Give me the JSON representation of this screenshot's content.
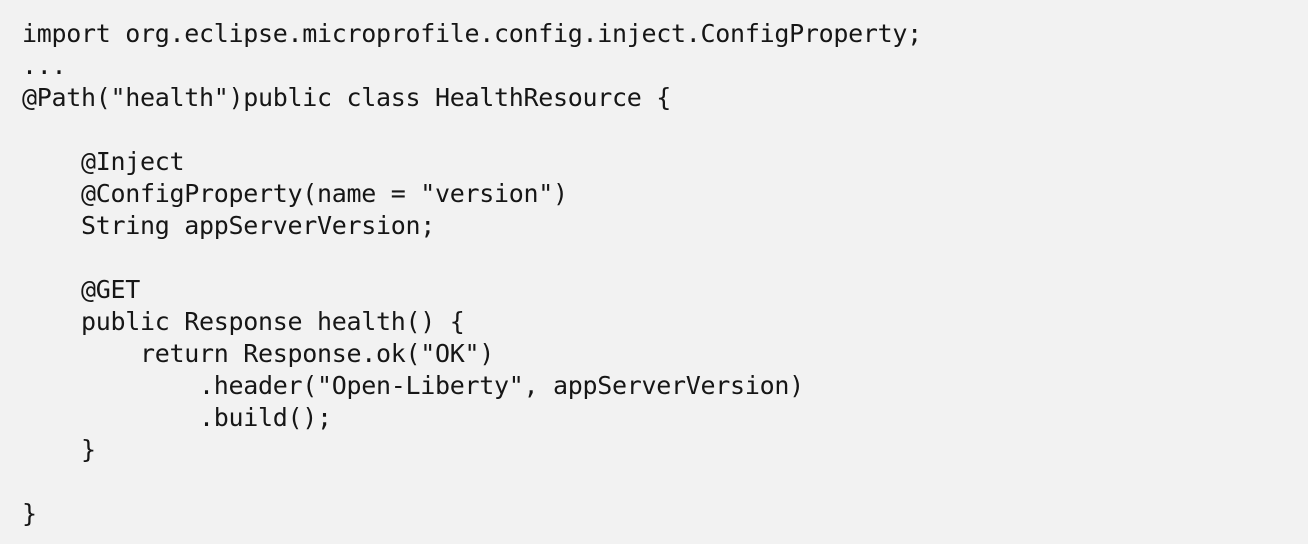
{
  "code": {
    "lines": [
      "import org.eclipse.microprofile.config.inject.ConfigProperty;",
      "...",
      "@Path(\"health\")public class HealthResource {",
      "",
      "    @Inject",
      "    @ConfigProperty(name = \"version\")",
      "    String appServerVersion;",
      "",
      "    @GET",
      "    public Response health() {",
      "        return Response.ok(\"OK\")",
      "            .header(\"Open-Liberty\", appServerVersion)",
      "            .build();",
      "    }",
      "",
      "}"
    ]
  }
}
